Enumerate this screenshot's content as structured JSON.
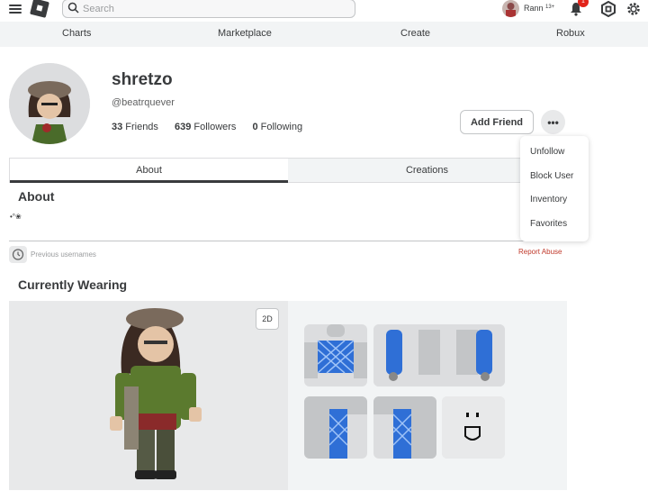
{
  "topbar": {
    "search_placeholder": "Search",
    "user_name": "Rann",
    "age_badge": "13+",
    "notification_count": "1"
  },
  "subnav": {
    "items": [
      "Charts",
      "Marketplace",
      "Create",
      "Robux"
    ]
  },
  "profile": {
    "display_name": "shretzo",
    "handle": "@beatrquever",
    "friends_count": "33",
    "friends_label": "Friends",
    "followers_count": "639",
    "followers_label": "Followers",
    "following_count": "0",
    "following_label": "Following",
    "add_friend_label": "Add Friend",
    "more_label": "•••"
  },
  "tabs": [
    "About",
    "Creations"
  ],
  "about": {
    "title": "About",
    "bio": "•°❀",
    "previous_usernames": "Previous usernames",
    "report_abuse": "Report Abuse"
  },
  "wearing": {
    "title": "Currently Wearing",
    "toggle_2d": "2D"
  },
  "dropdown": {
    "items": [
      "Unfollow",
      "Block User",
      "Inventory",
      "Favorites"
    ]
  },
  "colors": {
    "accent_blue": "#3b82f6",
    "report_red": "#c0392b",
    "notif_red": "#e2231a"
  }
}
